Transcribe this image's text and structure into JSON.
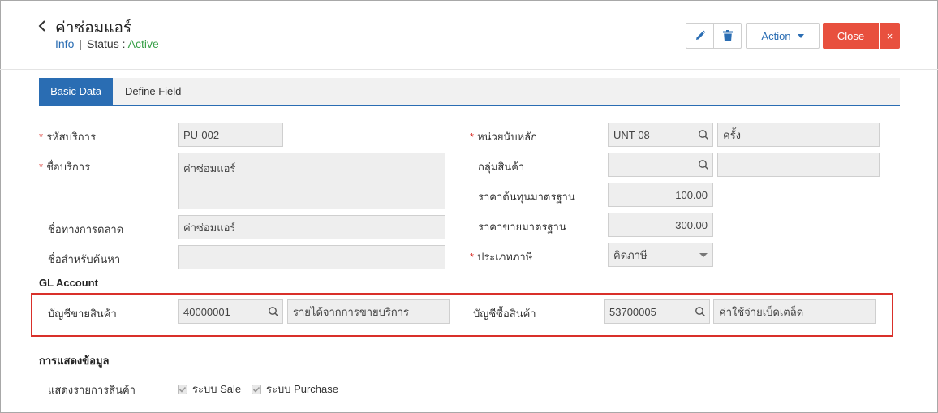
{
  "header": {
    "title": "ค่าซ่อมแอร์",
    "info_link": "Info",
    "status_label": "Status",
    "status_colon": ":",
    "status_value": "Active",
    "action_label": "Action",
    "close_label": "Close",
    "close_x": "×"
  },
  "tabs": [
    {
      "label": "Basic Data",
      "active": true
    },
    {
      "label": "Define Field",
      "active": false
    }
  ],
  "form": {
    "service_code": {
      "label": "รหัสบริการ",
      "value": "PU-002",
      "required": "*"
    },
    "service_name": {
      "label": "ชื่อบริการ",
      "value": "ค่าซ่อมแอร์",
      "required": "*"
    },
    "marketing_name": {
      "label": "ชื่อทางการตลาด",
      "value": "ค่าซ่อมแอร์"
    },
    "search_name": {
      "label": "ชื่อสำหรับค้นหา",
      "value": ""
    },
    "main_unit": {
      "label": "หน่วยนับหลัก",
      "code": "UNT-08",
      "name": "ครั้ง",
      "required": "*"
    },
    "product_group": {
      "label": "กลุ่มสินค้า",
      "code": "",
      "name": ""
    },
    "std_cost": {
      "label": "ราคาต้นทุนมาตรฐาน",
      "value": "100.00"
    },
    "std_price": {
      "label": "ราคาขายมาตรฐาน",
      "value": "300.00"
    },
    "tax_type": {
      "label": "ประเภทภาษี",
      "value": "คิดภาษี",
      "required": "*"
    }
  },
  "gl_account": {
    "title": "GL Account",
    "sales_account": {
      "label": "บัญชีขายสินค้า",
      "code": "40000001",
      "name": "รายได้จากการขายบริการ"
    },
    "purchase_account": {
      "label": "บัญชีซื้อสินค้า",
      "code": "53700005",
      "name": "ค่าใช้จ่ายเบ็ดเตล็ด"
    }
  },
  "display": {
    "title": "การแสดงข้อมูล",
    "show_items_label": "แสดงรายการสินค้า",
    "checkbox_sale": "ระบบ Sale",
    "checkbox_purchase": "ระบบ Purchase"
  },
  "colors": {
    "primary": "#2a6db3",
    "danger": "#e8503e",
    "active_status": "#3aa14a",
    "highlight_border": "#d9302a"
  }
}
